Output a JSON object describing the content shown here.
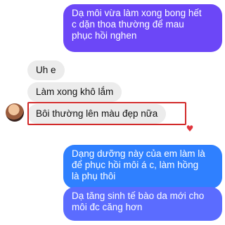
{
  "messages": [
    {
      "id": "m1",
      "direction": "outgoing",
      "text_lines": [
        "Dạ môi vừa làm xong bong hết",
        "c dặn thoa thường để mau",
        "phục hồi nghen"
      ]
    },
    {
      "id": "m2",
      "direction": "incoming",
      "text": "Uh e"
    },
    {
      "id": "m3",
      "direction": "incoming",
      "text": "Làm xong khô lắm"
    },
    {
      "id": "m4",
      "direction": "incoming",
      "text": "Bôi thường lên màu đẹp nữa",
      "highlighted": true,
      "reaction": "heart"
    },
    {
      "id": "m5",
      "direction": "outgoing",
      "text_lines": [
        "Dạng dưỡng này của em làm là",
        "để phục hồi môi á c, làm hồng",
        "là phụ thôi"
      ]
    },
    {
      "id": "m6",
      "direction": "outgoing",
      "text_lines": [
        "Dạ tăng sinh tế bào da mới cho",
        "môi đc căng hơn"
      ]
    }
  ],
  "colors": {
    "outgoing_purple": "#6c47f7",
    "outgoing_blue": "#2f80ff",
    "outgoing_indigo": "#5b6cff",
    "incoming_gray": "#ececec",
    "highlight_red": "#d22a2a",
    "heart_red": "#e0353d"
  },
  "icons": {
    "reaction": "heart-icon",
    "sender_avatar": "avatar"
  }
}
